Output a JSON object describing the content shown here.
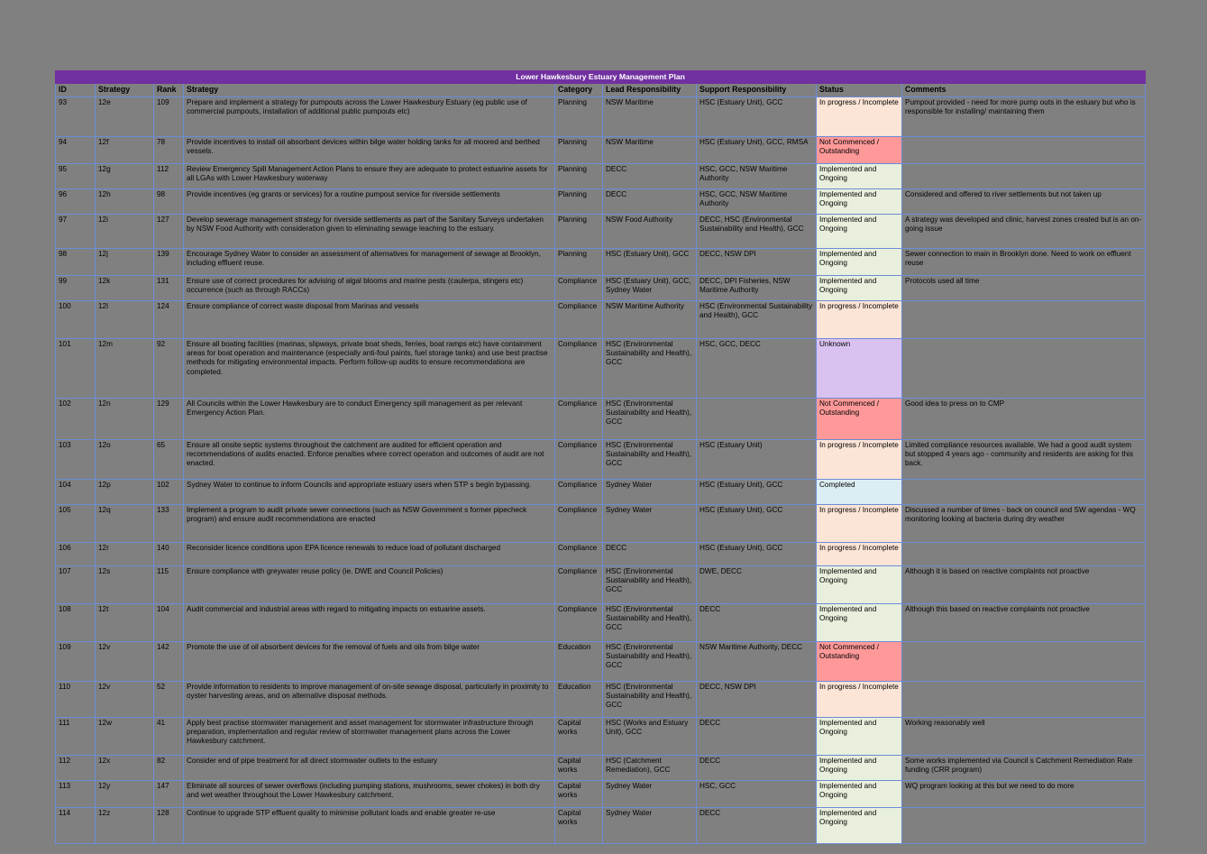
{
  "title": "Lower Hawkesbury Estuary Management Plan",
  "columns": [
    {
      "key": "id",
      "label": "ID"
    },
    {
      "key": "strategy_code",
      "label": "Strategy"
    },
    {
      "key": "rank",
      "label": "Rank"
    },
    {
      "key": "strategy",
      "label": "Strategy"
    },
    {
      "key": "category",
      "label": "Category"
    },
    {
      "key": "lead",
      "label": "Lead Responsibility"
    },
    {
      "key": "support",
      "label": "Support Responsibility"
    },
    {
      "key": "status",
      "label": "Status"
    },
    {
      "key": "comments",
      "label": "Comments"
    }
  ],
  "status_colors": {
    "In progress / Incomplete": "#FCE4D6",
    "Not Commenced / Outstanding": "#FF9999",
    "Implemented and Ongoing": "#E8EFDC",
    "Unknown": "#D9C2F0",
    "Completed": "#DCEEF3"
  },
  "theme": {
    "banner": "#7030A0",
    "banner_text": "#FFFFFF",
    "gridline": "#6C8CD5",
    "page_background": "#808080"
  },
  "rows": [
    {
      "id": "93",
      "strategy_code": "12e",
      "rank": "109",
      "strategy": "Prepare and implement a strategy for pumpouts across the Lower Hawkesbury Estuary (eg public use of commercial pumpouts, installation of additional public pumpouts etc)",
      "category": "Planning",
      "lead": "NSW Maritime",
      "support": "HSC (Estuary Unit), GCC",
      "status": "In progress / Incomplete",
      "status_class": "s-inprogress",
      "comments": "Pumpout provided - need for more pump outs in the estuary but who is responsible for  installing/ maintaining them"
    },
    {
      "id": "94",
      "strategy_code": "12f",
      "rank": "78",
      "strategy": "Provide incentives to install oil absorbant devices within bilge water holding tanks for all moored and berthed vessels.",
      "category": "Planning",
      "lead": "NSW Maritime",
      "support": "HSC (Estuary Unit), GCC, RMSA",
      "status": "Not Commenced / Outstanding",
      "status_class": "s-notcommenced",
      "comments": ""
    },
    {
      "id": "95",
      "strategy_code": "12g",
      "rank": "112",
      "strategy": "Review Emergency Spill Management Action Plans to ensure they are adequate to protect estuarine assets for all LGAs with Lower Hawkesbury waterway",
      "category": "Planning",
      "lead": "DECC",
      "support": "HSC, GCC, NSW Maritime Authority",
      "status": "Implemented and Ongoing",
      "status_class": "s-implemented",
      "comments": ""
    },
    {
      "id": "96",
      "strategy_code": "12h",
      "rank": "98",
      "strategy": "Provide incentives (eg grants or services) for a routine pumpout service for riverside settlements",
      "category": "Planning",
      "lead": "DECC",
      "support": "HSC, GCC, NSW Maritime Authority",
      "status": "Implemented and Ongoing",
      "status_class": "s-implemented",
      "comments": "Considered and offered to river settlements but not taken up"
    },
    {
      "id": "97",
      "strategy_code": "12i",
      "rank": "127",
      "strategy": "Develop sewerage management strategy for riverside settlements as part of the  Sanitary Surveys  undertaken by NSW Food Authority with consideration given to  eliminating sewage leaching to the estuary.",
      "category": "Planning",
      "lead": "NSW Food Authority",
      "support": "DECC, HSC (Environmental Sustainability and Health), GCC",
      "status": "Implemented and Ongoing",
      "status_class": "s-implemented",
      "comments": "A strategy was developed and clinic, harvest zones created but is an on-going issue"
    },
    {
      "id": "98",
      "strategy_code": "12j",
      "rank": "139",
      "strategy": "Encourage Sydney Water to consider an assessment of alternatives for management of sewage at Brooklyn, including effluent reuse.",
      "category": "Planning",
      "lead": "HSC (Estuary Unit), GCC",
      "support": "DECC, NSW DPI",
      "status": "Implemented and Ongoing",
      "status_class": "s-implemented",
      "comments": "Sewer connection to main in Brooklyn done. Need to work on effluent reuse"
    },
    {
      "id": "99",
      "strategy_code": "12k",
      "rank": "131",
      "strategy": "Ensure use of correct procedures for advising of algal blooms and marine pests (caulerpa, stingers etc) occurrence (such as through RACCs)",
      "category": "Compliance",
      "lead": "HSC (Estuary Unit), GCC, Sydney Water",
      "support": "DECC, DPI Fisheries, NSW Maritime Authority",
      "status": "Implemented and Ongoing",
      "status_class": "s-implemented",
      "comments": "Protocols used all time"
    },
    {
      "id": "100",
      "strategy_code": "12l",
      "rank": "124",
      "strategy": "Ensure compliance of correct waste disposal from Marinas and vessels",
      "category": "Compliance",
      "lead": "NSW Maritime Authority",
      "support": "HSC (Environmental Sustainability and Health), GCC",
      "status": "In progress / Incomplete",
      "status_class": "s-inprogress",
      "comments": ""
    },
    {
      "id": "101",
      "strategy_code": "12m",
      "rank": "92",
      "strategy": "Ensure all boating facilities (marinas, slipways, private boat sheds, ferries, boat ramps etc) have containment areas for boat operation and maintenance (especially anti-foul paints, fuel storage tanks) and use best practise methods for mitigating environmental impacts. Perform follow-up audits to ensure recommendations are completed.",
      "category": "Compliance",
      "lead": "HSC (Environmental Sustainability and Health), GCC",
      "support": "HSC, GCC, DECC",
      "status": "Unknown",
      "status_class": "s-unknown",
      "comments": ""
    },
    {
      "id": "102",
      "strategy_code": "12n",
      "rank": "129",
      "strategy": "All Councils within the Lower Hawkesbury are to conduct Emergency spill management as per relevant Emergency Action Plan.",
      "category": "Compliance",
      "lead": "HSC (Environmental Sustainability and Health), GCC",
      "support": "",
      "status": "Not Commenced / Outstanding",
      "status_class": "s-notcommenced",
      "comments": "Good idea to press on to CMP"
    },
    {
      "id": "103",
      "strategy_code": "12o",
      "rank": "65",
      "strategy": "Ensure all onsite septic systems throughout the catchment are audited for efficient operation and recommendations of audits enacted. Enforce penalties where correct operation and outcomes of audit are not enacted.",
      "category": "Compliance",
      "lead": "HSC (Environmental Sustainability and Health), GCC",
      "support": "HSC (Estuary Unit)",
      "status": "In progress / Incomplete",
      "status_class": "s-inprogress",
      "comments": "Limited compliance resources available. We had a good audit system but stopped 4 years ago - community and residents are asking for this back."
    },
    {
      "id": "104",
      "strategy_code": "12p",
      "rank": "102",
      "strategy": "Sydney Water to continue to inform Councils and appropriate estuary users when STP  s begin bypassing.",
      "category": "Compliance",
      "lead": "Sydney Water",
      "support": "HSC (Estuary Unit), GCC",
      "status": "Completed",
      "status_class": "s-completed",
      "comments": ""
    },
    {
      "id": "105",
      "strategy_code": "12q",
      "rank": "133",
      "strategy": "Implement a program to audit private sewer connections (such as NSW Government  s former  pipecheck  program) and ensure audit recommendations are enacted",
      "category": "Compliance",
      "lead": "Sydney Water",
      "support": "HSC (Estuary Unit), GCC",
      "status": "In progress / Incomplete",
      "status_class": "s-inprogress",
      "comments": "Discussed a number of times - back on council and SW agendas - WQ monitoring looking at bacteria during dry weather"
    },
    {
      "id": "106",
      "strategy_code": "12r",
      "rank": "140",
      "strategy": "Reconsider licence conditions upon EPA licence renewals to reduce load of pollutant discharged",
      "category": "Compliance",
      "lead": "DECC",
      "support": "HSC (Estuary Unit), GCC",
      "status": "In progress / Incomplete",
      "status_class": "s-inprogress",
      "comments": ""
    },
    {
      "id": "107",
      "strategy_code": "12s",
      "rank": "115",
      "strategy": "Ensure compliance with greywater reuse policy (ie. DWE and Council Policies)",
      "category": "Compliance",
      "lead": "HSC (Environmental Sustainability and Health), GCC",
      "support": "DWE, DECC",
      "status": "Implemented and Ongoing",
      "status_class": "s-implemented",
      "comments": "Although it is based on reactive complaints not proactive"
    },
    {
      "id": "108",
      "strategy_code": "12t",
      "rank": "104",
      "strategy": "Audit commercial and industrial areas with regard to mitigating impacts on estuarine assets.",
      "category": "Compliance",
      "lead": "HSC (Environmental Sustainability and Health), GCC",
      "support": "DECC",
      "status": "Implemented and Ongoing",
      "status_class": "s-implemented",
      "comments": "Although this based on reactive complaints not proactive"
    },
    {
      "id": "109",
      "strategy_code": "12v",
      "rank": "142",
      "strategy": "Promote the use of oil absorbent devices for the removal of fuels and oils from bilge water",
      "category": "Education",
      "lead": "HSC (Environmental Sustainability and Health), GCC",
      "support": "NSW Maritime Authority, DECC",
      "status": "Not Commenced / Outstanding",
      "status_class": "s-notcommenced",
      "comments": ""
    },
    {
      "id": "110",
      "strategy_code": "12v",
      "rank": "52",
      "strategy": "Provide information to residents to improve management of on-site sewage disposal, particularly in proximity to oyster harvesting areas, and on alternative disposal methods.",
      "category": "Education",
      "lead": "HSC (Environmental Sustainability and Health), GCC",
      "support": "DECC, NSW DPI",
      "status": "In progress / Incomplete",
      "status_class": "s-inprogress",
      "comments": ""
    },
    {
      "id": "111",
      "strategy_code": "12w",
      "rank": "41",
      "strategy": "Apply best practise stormwater management and asset management for stormwater infrastructure through preparation, implementation and regular review of stormwater management plans across the Lower Hawkesbury catchment.",
      "category": "Capital works",
      "lead": "HSC (Works and Estuary Unit), GCC",
      "support": "DECC",
      "status": "Implemented and Ongoing",
      "status_class": "s-implemented",
      "comments": "Working reasonably well"
    },
    {
      "id": "112",
      "strategy_code": "12x",
      "rank": "82",
      "strategy": "Consider end of pipe treatment for all direct stormwater outlets to the estuary",
      "category": "Capital works",
      "lead": "HSC (Catchment Remediation), GCC",
      "support": "DECC",
      "status": "Implemented and Ongoing",
      "status_class": "s-implemented",
      "comments": "Some works implemented via Council  s Catchment Remediation Rate funding (CRR program)"
    },
    {
      "id": "113",
      "strategy_code": "12y",
      "rank": "147",
      "strategy": "Eliminate all sources of sewer overflows (including pumping stations, mushrooms, sewer chokes) in both dry and wet weather throughout the Lower Hawkesbury catchment.",
      "category": "Capital works",
      "lead": "Sydney Water",
      "support": "HSC, GCC",
      "status": "Implemented and Ongoing",
      "status_class": "s-implemented",
      "comments": "WQ program looking at this but we need to do more"
    },
    {
      "id": "114",
      "strategy_code": "12z",
      "rank": "128",
      "strategy": "Continue to upgrade STP effluent quality to minimise pollutant loads and enable greater re-use",
      "category": "Capital works",
      "lead": "Sydney Water",
      "support": "DECC",
      "status": "Implemented and Ongoing",
      "status_class": "s-implemented",
      "comments": ""
    }
  ]
}
